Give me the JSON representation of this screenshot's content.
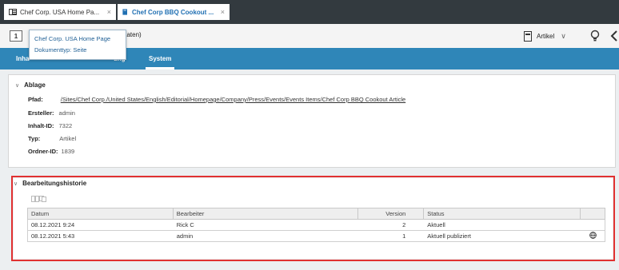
{
  "tabs": [
    {
      "label": "Chef Corp. USA Home Pa...",
      "close": "×"
    },
    {
      "label": "Chef Corp BBQ Cookout ...",
      "close": "×"
    }
  ],
  "header": {
    "doc_icon_text": "1",
    "title": "aaten)",
    "type_label": "Artikel",
    "chevron": "∨"
  },
  "tooltip": {
    "line1": "Chef Corp. USA Home Page",
    "line2": "Dokumenttyp: Seite"
  },
  "nav": {
    "tab1": "Inha",
    "tab2": "ung",
    "tab3": "System"
  },
  "ablage": {
    "collapse": "∨",
    "title": "Ablage",
    "pfad_label": "Pfad:",
    "pfad_value": "/Sites/Chef Corp./United States/English/Editorial/Homepage/Company/Press/Events/Events Items/Chef Corp BBQ Cookout Article",
    "ersteller_label": "Ersteller:",
    "ersteller_value": "admin",
    "inhalt_label": "Inhalt-ID:",
    "inhalt_value": "7322",
    "typ_label": "Typ:",
    "typ_value": "Artikel",
    "ordner_label": "Ordner-ID:",
    "ordner_value": "1839"
  },
  "history": {
    "collapse": "∨",
    "title": "Bearbeitungshistorie",
    "columns": [
      "Datum",
      "Bearbeiter",
      "Version",
      "Status"
    ],
    "rows": [
      {
        "datum": "08.12.2021 9:24",
        "bearbeiter": "Rick C",
        "version": "2",
        "status": "Aktuell"
      },
      {
        "datum": "08.12.2021 5:43",
        "bearbeiter": "admin",
        "version": "1",
        "status": "Aktuell publiziert"
      }
    ]
  },
  "colors": {
    "tabbar": "#333a3f",
    "nav_blue": "#2f86b8",
    "highlight_red": "#e03131",
    "active_tab_text": "#1f6fb2"
  }
}
